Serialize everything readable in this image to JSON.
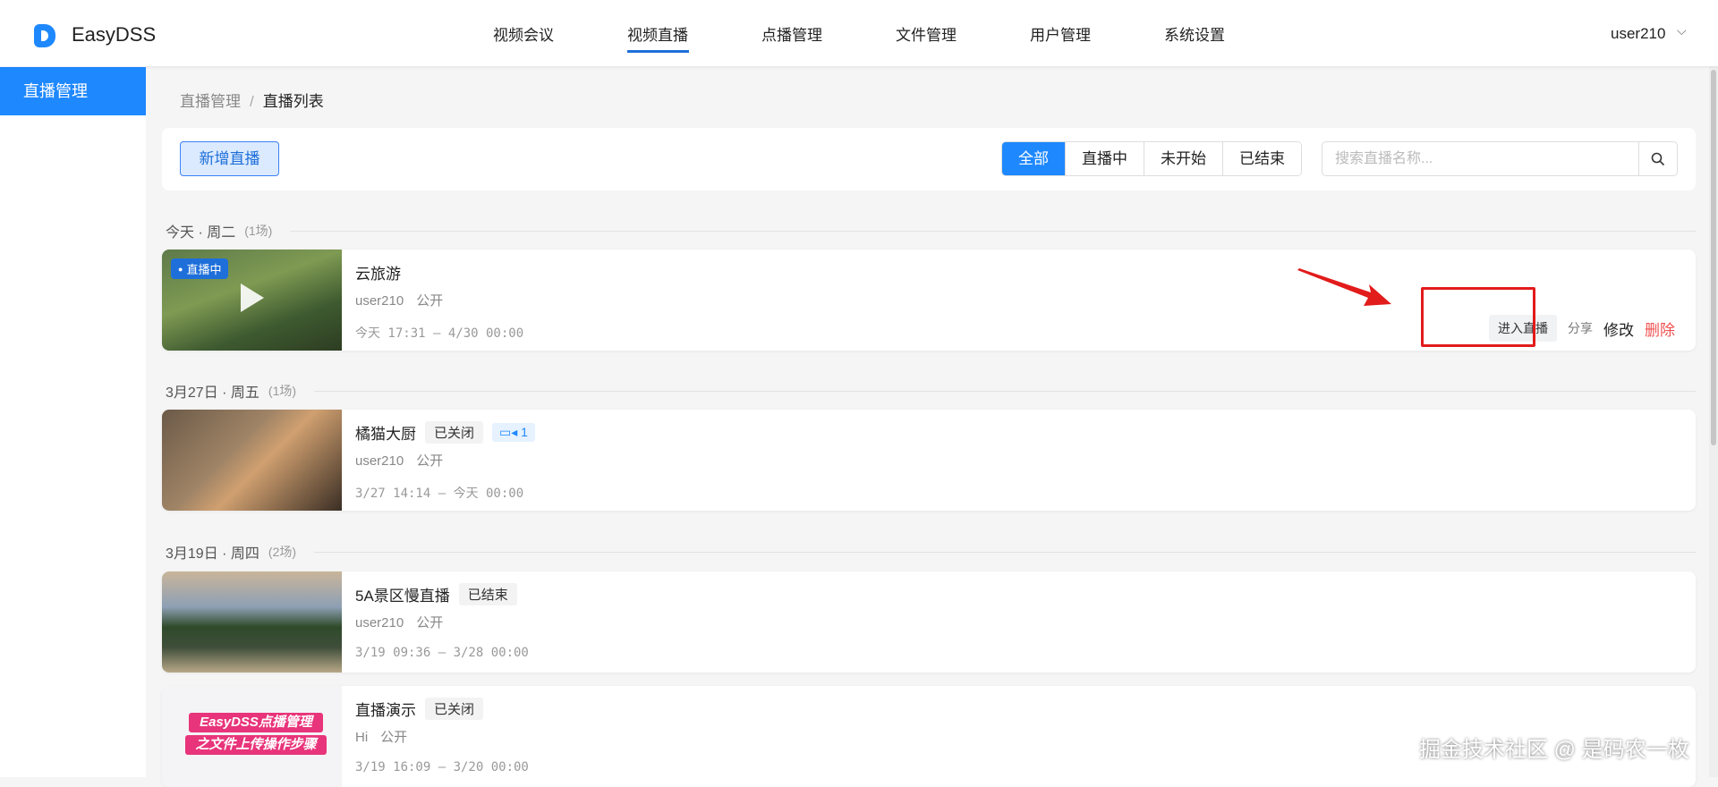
{
  "header": {
    "brand": "EasyDSS",
    "nav": [
      "视频会议",
      "视频直播",
      "点播管理",
      "文件管理",
      "用户管理",
      "系统设置"
    ],
    "active_nav": "视频直播",
    "user": "user210"
  },
  "sidebar": {
    "items": [
      {
        "label": "直播管理",
        "active": true
      }
    ]
  },
  "breadcrumb": {
    "parent": "直播管理",
    "separator": "/",
    "current": "直播列表"
  },
  "toolbar": {
    "add_label": "新增直播",
    "filters": [
      "全部",
      "直播中",
      "未开始",
      "已结束"
    ],
    "active_filter": "全部",
    "search_placeholder": "搜索直播名称...",
    "search_value": ""
  },
  "groups": [
    {
      "heading": "今天 · 周二",
      "count": "(1场)"
    },
    {
      "heading": "3月27日 · 周五",
      "count": "(1场)"
    },
    {
      "heading": "3月19日 · 周四",
      "count": "(2场)"
    }
  ],
  "streams": [
    {
      "title": "云旅游",
      "badge": "直播中",
      "owner": "user210",
      "visibility": "公开",
      "time": "今天 17:31 – 4/30 00:00",
      "actions": {
        "enter": "进入直播",
        "share": "分享",
        "edit": "修改",
        "delete": "删除"
      }
    },
    {
      "title": "橘猫大厨",
      "status": "已关闭",
      "viewers": "1",
      "owner": "user210",
      "visibility": "公开",
      "time": "3/27 14:14 – 今天 00:00"
    },
    {
      "title": "5A景区慢直播",
      "status": "已结束",
      "owner": "user210",
      "visibility": "公开",
      "time": "3/19 09:36 – 3/28 00:00"
    },
    {
      "title": "直播演示",
      "status": "已关闭",
      "owner": "Hi",
      "visibility": "公开",
      "time": "3/19 16:09 – 3/20 00:00",
      "thumb_text": [
        "EasyDSS点播管理",
        "之文件上传操作步骤"
      ]
    }
  ],
  "watermark": "掘金技术社区 @ 是码农一枚",
  "colors": {
    "primary": "#1e88ff",
    "danger": "#f05050",
    "annotation": "#e21b1b"
  }
}
